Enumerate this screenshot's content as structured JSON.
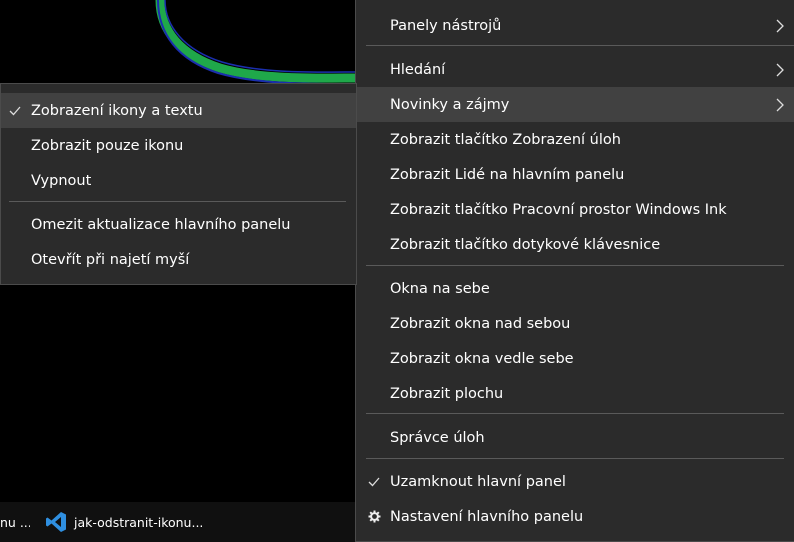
{
  "main_menu": {
    "items": [
      {
        "label": "Panely nástrojů",
        "has_submenu": true
      },
      {
        "label": "Hledání",
        "has_submenu": true
      },
      {
        "label": "Novinky a zájmy",
        "has_submenu": true,
        "highlighted": true
      },
      {
        "label": "Zobrazit tlačítko Zobrazení úloh"
      },
      {
        "label": "Zobrazit Lidé na hlavním panelu"
      },
      {
        "label": "Zobrazit tlačítko Pracovní prostor Windows Ink"
      },
      {
        "label": "Zobrazit tlačítko dotykové klávesnice"
      },
      {
        "label": "Okna na sebe"
      },
      {
        "label": "Zobrazit okna nad sebou"
      },
      {
        "label": "Zobrazit okna vedle sebe"
      },
      {
        "label": "Zobrazit plochu"
      },
      {
        "label": "Správce úloh"
      },
      {
        "label": "Uzamknout hlavní panel",
        "checked": true
      },
      {
        "label": "Nastavení hlavního panelu",
        "icon": "gear-icon"
      }
    ]
  },
  "sub_menu": {
    "items": [
      {
        "label": "Zobrazení ikony a textu",
        "checked": true,
        "highlighted": true
      },
      {
        "label": "Zobrazit pouze ikonu"
      },
      {
        "label": "Vypnout"
      },
      {
        "label": "Omezit aktualizace hlavního panelu"
      },
      {
        "label": "Otevřít při najetí myší"
      }
    ]
  },
  "taskbar": {
    "items": [
      {
        "label": "nu ..."
      },
      {
        "label": "jak-odstranit-ikonu...",
        "icon": "vscode-icon"
      }
    ]
  },
  "colors": {
    "menu_bg": "#2b2b2b",
    "menu_highlight": "#414141",
    "separator": "#5a5a5a",
    "curve_green": "#1fa84a",
    "taskbar_bg": "#101010",
    "vscode_blue": "#2f8fe0"
  }
}
